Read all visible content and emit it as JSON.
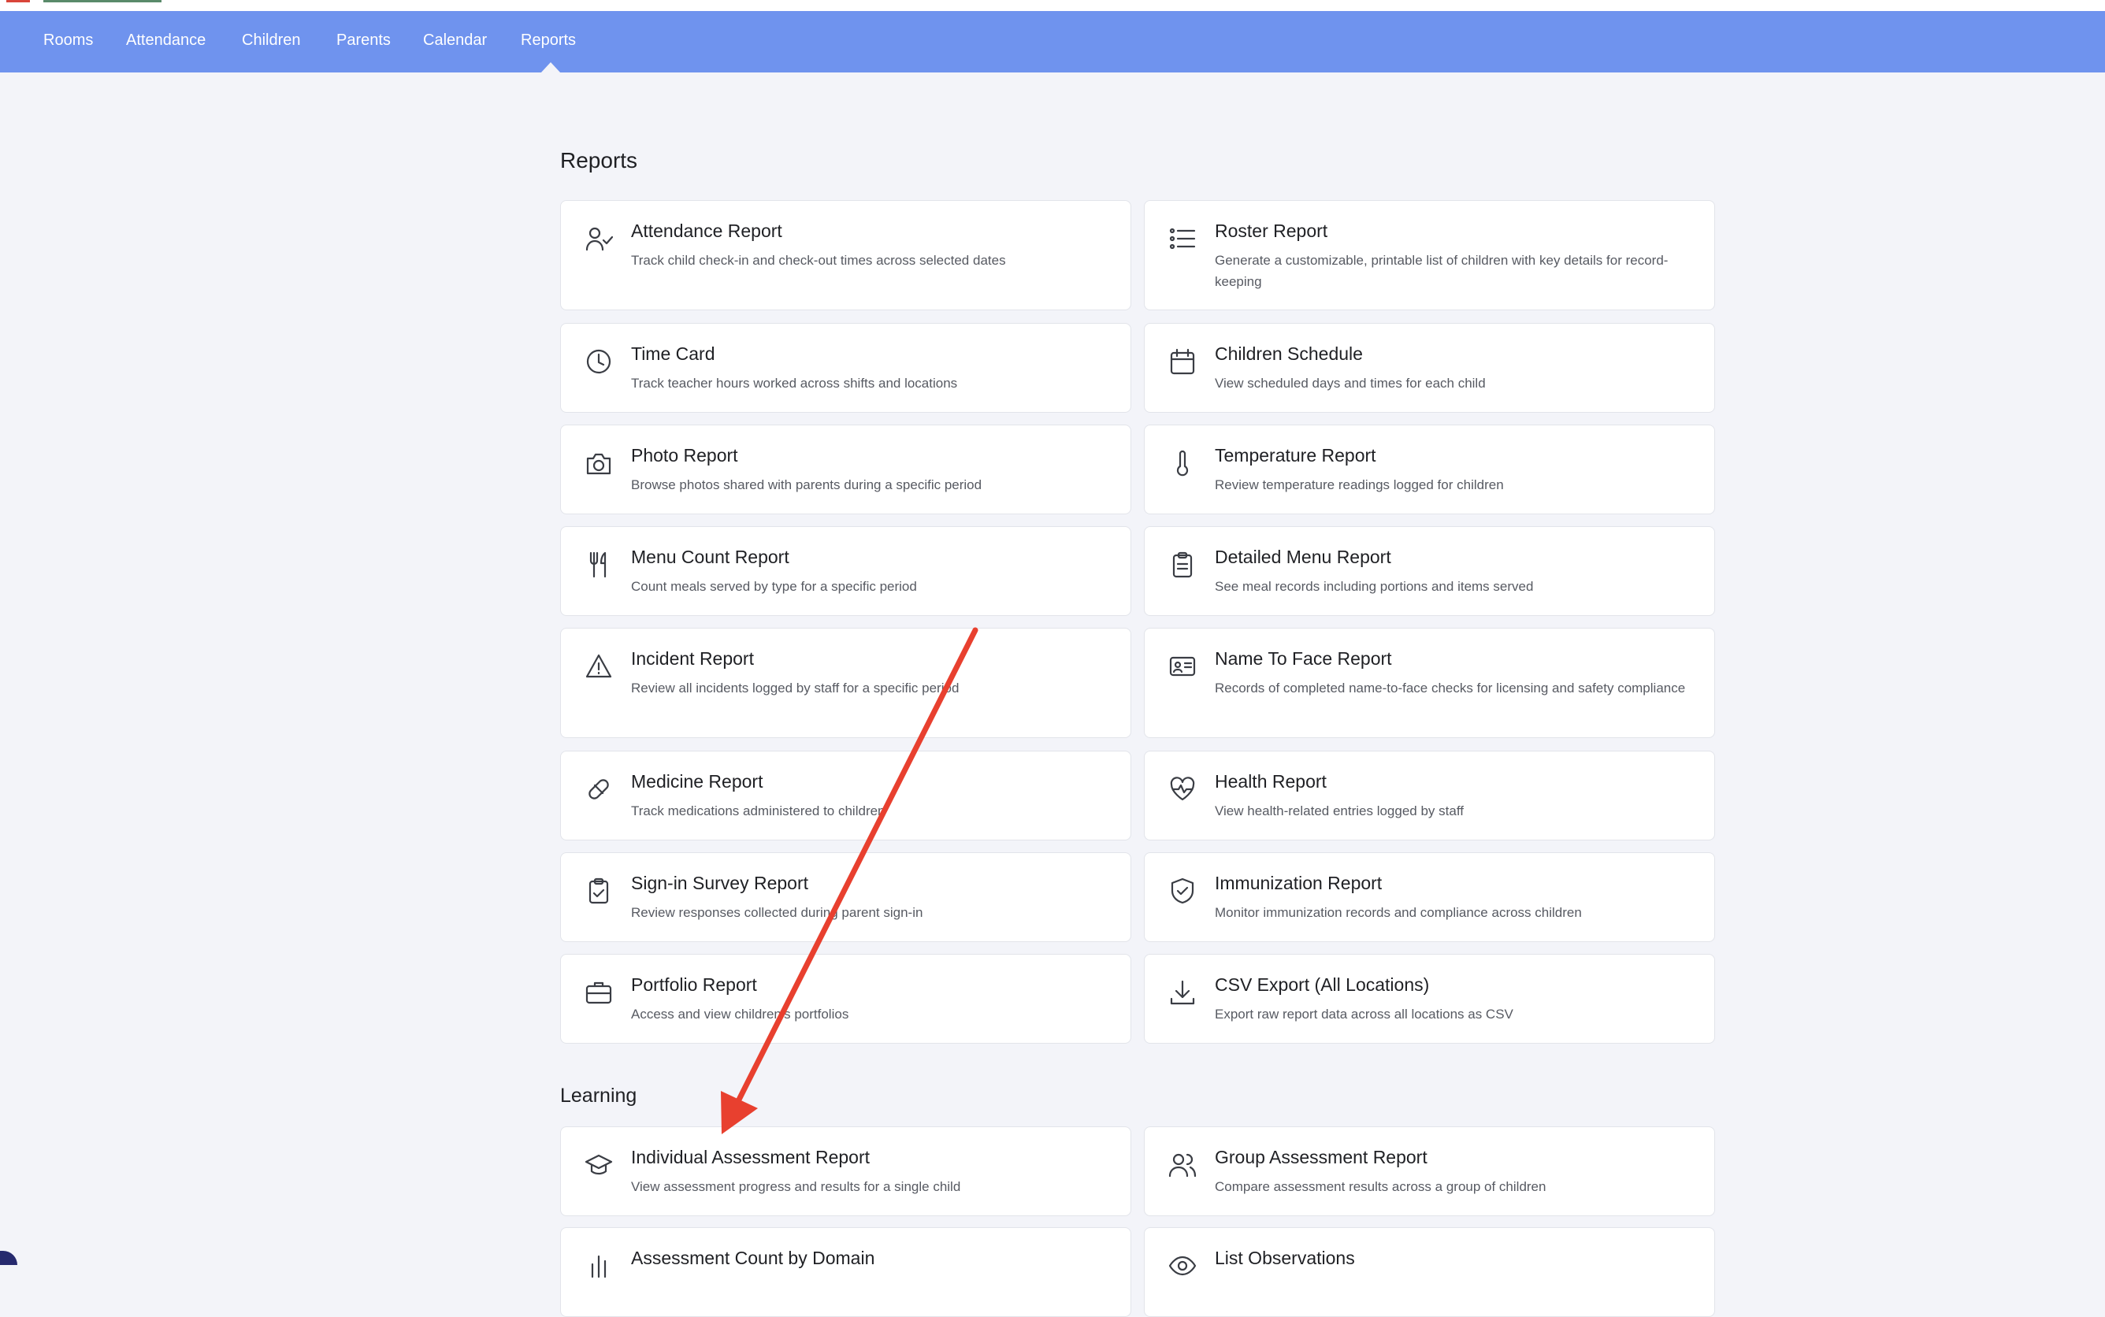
{
  "nav": {
    "items": [
      "Rooms",
      "Attendance",
      "Children",
      "Parents",
      "Calendar",
      "Reports"
    ],
    "active": "Reports"
  },
  "reports": {
    "title": "Reports",
    "cards": [
      {
        "title": "Attendance Report",
        "desc": "Track child check-in and check-out times across selected dates",
        "icon": "user-check-icon"
      },
      {
        "title": "Roster Report",
        "desc": "Generate a customizable, printable list of children with key details for record-keeping",
        "icon": "list-icon"
      },
      {
        "title": "Time Card",
        "desc": "Track teacher hours worked across shifts and locations",
        "icon": "clock-icon"
      },
      {
        "title": "Children Schedule",
        "desc": "View scheduled days and times for each child",
        "icon": "calendar-icon"
      },
      {
        "title": "Photo Report",
        "desc": "Browse photos shared with parents during a specific period",
        "icon": "camera-icon"
      },
      {
        "title": "Temperature Report",
        "desc": "Review temperature readings logged for children",
        "icon": "thermometer-icon"
      },
      {
        "title": "Menu Count Report",
        "desc": "Count meals served by type for a specific period",
        "icon": "utensils-icon"
      },
      {
        "title": "Detailed Menu Report",
        "desc": "See meal records including portions and items served",
        "icon": "clipboard-icon"
      },
      {
        "title": "Incident Report",
        "desc": "Review all incidents logged by staff for a specific period",
        "icon": "warning-icon"
      },
      {
        "title": "Name To Face Report",
        "desc": "Records of completed name-to-face checks for licensing and safety compliance",
        "icon": "id-card-icon"
      },
      {
        "title": "Medicine Report",
        "desc": "Track medications administered to children",
        "icon": "pill-icon"
      },
      {
        "title": "Health Report",
        "desc": "View health-related entries logged by staff",
        "icon": "heart-pulse-icon"
      },
      {
        "title": "Sign-in Survey Report",
        "desc": "Review responses collected during parent sign-in",
        "icon": "clipboard-check-icon"
      },
      {
        "title": "Immunization Report",
        "desc": "Monitor immunization records and compliance across children",
        "icon": "shield-check-icon"
      },
      {
        "title": "Portfolio Report",
        "desc": "Access and view children's portfolios",
        "icon": "briefcase-icon"
      },
      {
        "title": "CSV Export (All Locations)",
        "desc": "Export raw report data across all locations as CSV",
        "icon": "download-icon"
      }
    ]
  },
  "learning": {
    "title": "Learning",
    "cards": [
      {
        "title": "Individual Assessment Report",
        "desc": "View assessment progress and results for a single child",
        "icon": "graduation-cap-icon"
      },
      {
        "title": "Group Assessment Report",
        "desc": "Compare assessment results across a group of children",
        "icon": "users-icon"
      },
      {
        "title": "Assessment Count by Domain",
        "desc": "",
        "icon": "bar-chart-icon"
      },
      {
        "title": "List Observations",
        "desc": "",
        "icon": "eye-icon"
      }
    ]
  },
  "annotation": {
    "color": "#e8402f"
  }
}
